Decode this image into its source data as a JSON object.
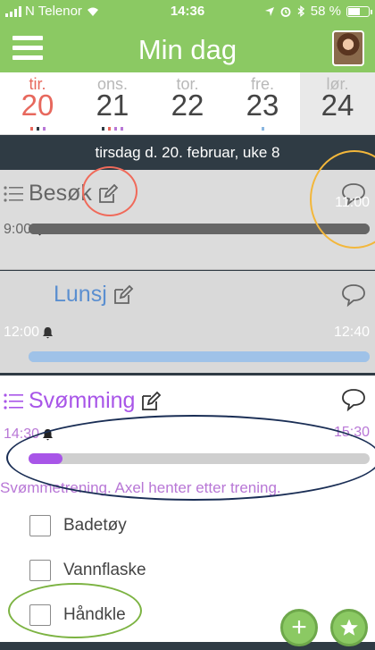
{
  "status_bar": {
    "carrier": "N Telenor",
    "time": "14:36",
    "battery": "58 %",
    "battery_level": 0.58
  },
  "header": {
    "title": "Min dag",
    "menu_icon": "hamburger-menu-icon",
    "avatar": "user-avatar"
  },
  "days": [
    {
      "name": "tir.",
      "number": "20",
      "active": true,
      "dots": [
        "#e7685d",
        "#2f3b44",
        "#b877d6"
      ]
    },
    {
      "name": "ons.",
      "number": "21",
      "active": false,
      "dots": [
        "#2f3b44",
        "#e7685d",
        "#b877d6",
        "#b877d6"
      ]
    },
    {
      "name": "tor.",
      "number": "22",
      "active": false,
      "dots": []
    },
    {
      "name": "fre.",
      "number": "23",
      "active": false,
      "dots": [
        "#8ab6e0"
      ]
    },
    {
      "name": "lør.",
      "number": "24",
      "active": false,
      "dots": []
    }
  ],
  "date_label": "tirsdag d. 20. februar, uke 8",
  "events": [
    {
      "title": "Besøk",
      "start": "9:00",
      "end": "11:00",
      "color": "#666666",
      "progress": 1.0,
      "has_list": true
    },
    {
      "title": "Lunsj",
      "start": "12:00",
      "end": "12:40",
      "color": "#7fa8d8",
      "progress": 1.0,
      "has_list": false
    },
    {
      "title": "Svømming",
      "start": "14:30",
      "end": "15:30",
      "color": "#a855e8",
      "progress": 0.1,
      "has_list": true,
      "note": "Svømmetrening. Axel henter etter trening.",
      "checklist": [
        "Badetøy",
        "Vannflaske",
        "Håndkle"
      ]
    }
  ],
  "colors": {
    "green": "#8bc963",
    "dark": "#2f3b44",
    "active_day": "#e7685d",
    "annotation_red": "#f06a5a",
    "annotation_yellow": "#f3b73b",
    "annotation_navy": "#1a2e55",
    "annotation_green": "#7cb342"
  },
  "buttons": {
    "add": "+",
    "add_icon": "plus-icon",
    "favorite_icon": "star-icon"
  }
}
